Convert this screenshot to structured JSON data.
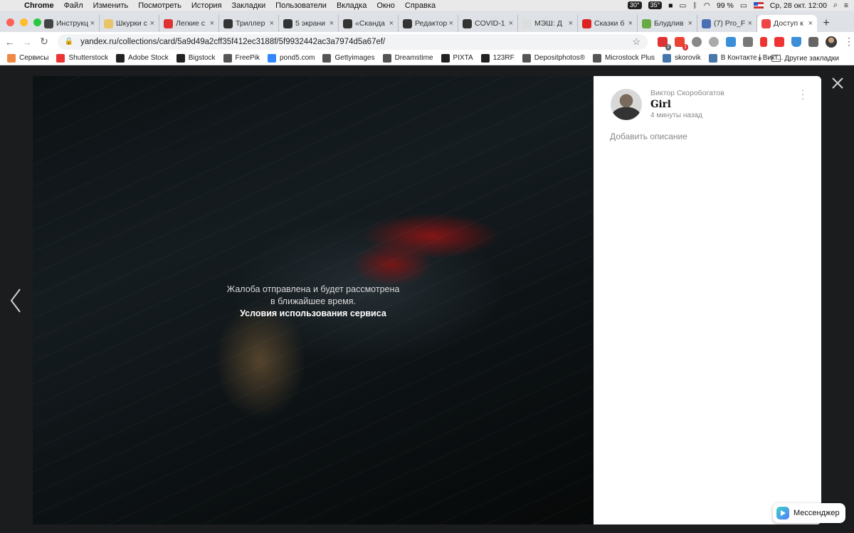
{
  "menubar": {
    "items": [
      "Chrome",
      "Файл",
      "Изменить",
      "Посмотреть",
      "История",
      "Закладки",
      "Пользователи",
      "Вкладка",
      "Окно",
      "Справка"
    ],
    "status": {
      "temp1": "30°",
      "temp2": "35°",
      "battery": "99 %",
      "datetime": "Ср, 28 окт.  12:00"
    }
  },
  "tabs": [
    {
      "title": "Инструкц",
      "color": "#444"
    },
    {
      "title": "Шкурки с",
      "color": "#e9c46a"
    },
    {
      "title": "Легкие с",
      "color": "#d33"
    },
    {
      "title": "Триллер",
      "color": "#333"
    },
    {
      "title": "5 экрани",
      "color": "#333"
    },
    {
      "title": "«Сканда",
      "color": "#333"
    },
    {
      "title": "Редактор",
      "color": "#333"
    },
    {
      "title": "COVID-1",
      "color": "#333"
    },
    {
      "title": "МЭШ: Д",
      "color": "#ddd"
    },
    {
      "title": "Сказки б",
      "color": "#d22"
    },
    {
      "title": "Блудлив",
      "color": "#6a4"
    },
    {
      "title": "(7) Pro_F",
      "color": "#4a6fb5"
    },
    {
      "title": "Доступ к",
      "color": "#e44",
      "active": true
    }
  ],
  "toolbar": {
    "url": "yandex.ru/collections/card/5a9d49a2cff35f412ec3188f/5f9932442ac3a7974d5a67ef/",
    "ext_badges": [
      "2",
      "1"
    ]
  },
  "bookmarks": {
    "items": [
      {
        "label": "Сервисы",
        "color": "#e84"
      },
      {
        "label": "Shutterstock",
        "color": "#e33"
      },
      {
        "label": "Adobe Stock",
        "color": "#222"
      },
      {
        "label": "Bigstock",
        "color": "#222"
      },
      {
        "label": "FreePik",
        "color": "#555"
      },
      {
        "label": "pond5.com",
        "color": "#38f"
      },
      {
        "label": "Gettyimages",
        "color": "#555"
      },
      {
        "label": "Dreamstime",
        "color": "#555"
      },
      {
        "label": "PIXTA",
        "color": "#222"
      },
      {
        "label": "123RF",
        "color": "#222"
      },
      {
        "label": "Depositphotos®",
        "color": "#555"
      },
      {
        "label": "Microstock Plus",
        "color": "#555"
      },
      {
        "label": "skorovik",
        "color": "#47a"
      },
      {
        "label": "В Контакте | Викт...",
        "color": "#4a76a8"
      }
    ],
    "overflow": "»",
    "other": "Другие закладки"
  },
  "viewer": {
    "notice_line1": "Жалоба отправлена и будет рассмотрена",
    "notice_line2": "в ближайшее время.",
    "notice_link": "Условия использования сервиса"
  },
  "card": {
    "author": "Виктор Скоробогатов",
    "title": "Girl",
    "time": "4 минуты назад",
    "add_description": "Добавить описание"
  },
  "messenger": {
    "label": "Мессенджер"
  }
}
